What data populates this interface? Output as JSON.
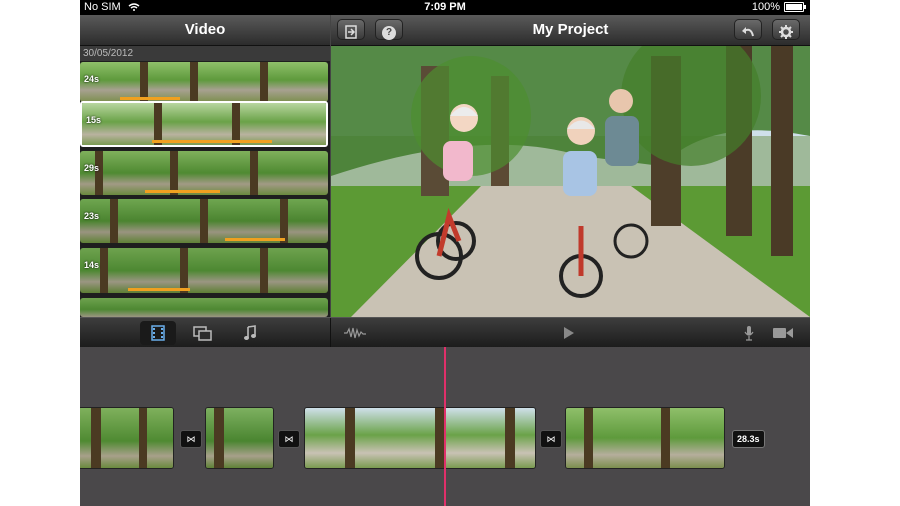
{
  "status_bar": {
    "carrier": "No SIM",
    "time": "7:09 PM",
    "battery": "100%"
  },
  "left_pane": {
    "title": "Video",
    "date": "30/05/2012",
    "clips": [
      {
        "duration": "24s"
      },
      {
        "duration": "15s"
      },
      {
        "duration": "29s"
      },
      {
        "duration": "23s"
      },
      {
        "duration": "14s"
      },
      {
        "duration": ""
      }
    ]
  },
  "project": {
    "title": "My Project"
  },
  "icons": {
    "import": "import-icon",
    "help": "?",
    "undo": "undo-icon",
    "settings": "gear-icon",
    "video": "film-icon",
    "photos": "photos-icon",
    "music": "music-note-icon",
    "audio": "waveform-icon",
    "play": "play-icon",
    "mic": "microphone-icon",
    "camera": "camera-icon"
  },
  "timeline": {
    "duration_label": "28.3s"
  },
  "colors": {
    "playhead": "#e0306a",
    "clip_used": "#f0a020",
    "selected_tool": "#6aaeea"
  }
}
